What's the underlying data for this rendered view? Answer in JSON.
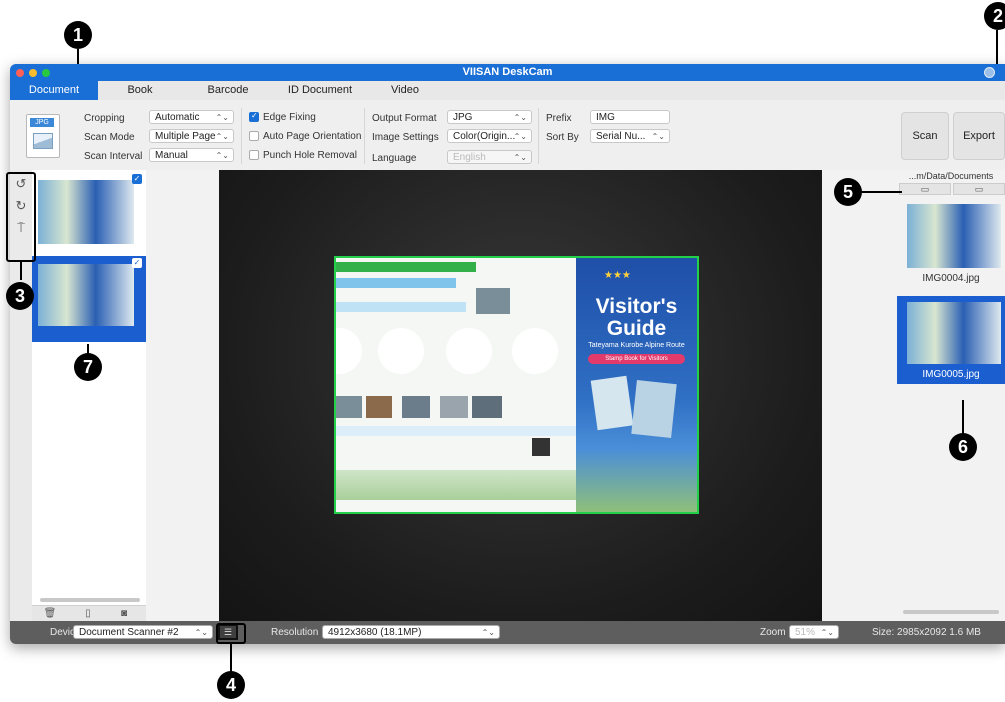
{
  "app": {
    "title": "VIISAN DeskCam"
  },
  "tabs": [
    "Document",
    "Book",
    "Barcode",
    "ID Document",
    "Video"
  ],
  "toolbar": {
    "format_icon_label": "JPG",
    "cropping_label": "Cropping",
    "cropping_value": "Automatic",
    "scan_mode_label": "Scan Mode",
    "scan_mode_value": "Multiple Page",
    "scan_interval_label": "Scan Interval",
    "scan_interval_value": "Manual",
    "edge_fixing_label": "Edge Fixing",
    "auto_orientation_label": "Auto Page Orientation",
    "punch_hole_label": "Punch Hole Removal",
    "output_format_label": "Output Format",
    "output_format_value": "JPG",
    "image_settings_label": "Image Settings",
    "image_settings_value": "Color(Origin...",
    "language_label": "Language",
    "language_value": "English",
    "prefix_label": "Prefix",
    "prefix_value": "IMG",
    "sort_by_label": "Sort By",
    "sort_by_value": "Serial Nu...",
    "scan_button": "Scan",
    "export_button": "Export"
  },
  "right_panel": {
    "path": "...m/Data/Documents",
    "files": [
      "IMG0004.jpg",
      "IMG0005.jpg"
    ]
  },
  "document_preview": {
    "title": "Visitor's",
    "title2": "Guide",
    "subtitle": "Tateyama Kurobe Alpine Route",
    "banner": "Stamp Book for Visitors"
  },
  "statusbar": {
    "device_label": "Device",
    "device_value": "Document Scanner #2",
    "resolution_label": "Resolution",
    "resolution_value": "4912x3680 (18.1MP)",
    "zoom_label": "Zoom",
    "zoom_value": "51%",
    "size_text": "Size: 2985x2092 1.6 MB"
  },
  "callouts": [
    "1",
    "2",
    "3",
    "4",
    "5",
    "6",
    "7"
  ],
  "colors": {
    "accent": "#1a6fd6",
    "crop_border": "#22d04a"
  }
}
